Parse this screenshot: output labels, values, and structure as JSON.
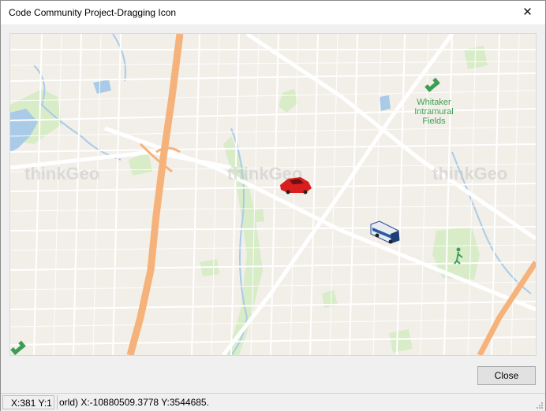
{
  "window": {
    "title": "Code Community Project-Dragging Icon",
    "close_glyph": "✕"
  },
  "map": {
    "place_label_line1": "Whitaker",
    "place_label_line2": "Intramural",
    "place_label_line3": "Fields",
    "watermark": "thinkGeo",
    "icons": [
      "car-icon",
      "bus-icon",
      "sports-field-icon",
      "golf-icon"
    ],
    "colors": {
      "land": "#f2efe9",
      "park": "#d8ecc8",
      "water": "#a9cbe8",
      "highway": "#f5b27a",
      "road": "#ffffff",
      "label": "#3e9d54"
    }
  },
  "buttons": {
    "close_label": "Close"
  },
  "status": {
    "screen_coords": "X:381 Y:1",
    "world_coords": "orld) X:-10880509.3778 Y:3544685.31"
  }
}
